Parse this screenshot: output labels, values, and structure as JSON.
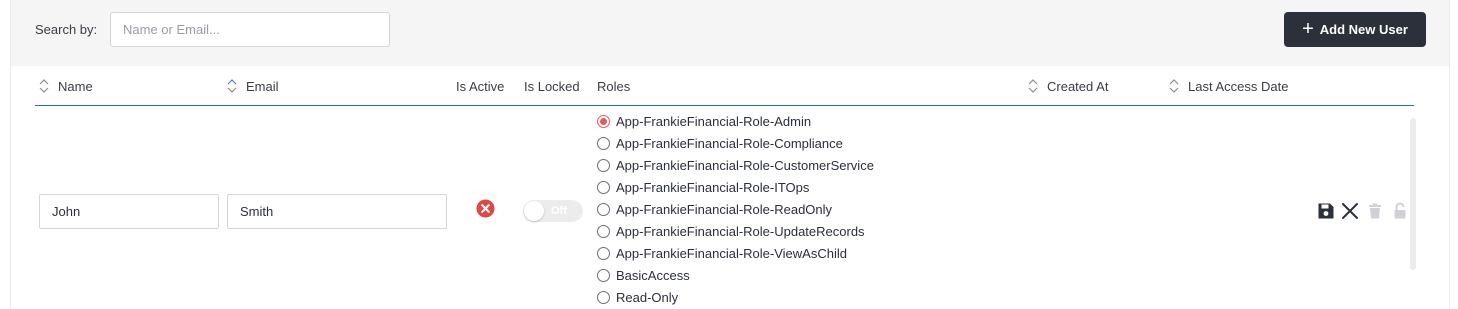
{
  "toolbar": {
    "search_label": "Search by:",
    "search_placeholder": "Name or Email...",
    "search_value": "",
    "add_button_label": "Add New User"
  },
  "columns": {
    "name": "Name",
    "email": "Email",
    "is_active": "Is Active",
    "is_locked": "Is Locked",
    "roles": "Roles",
    "created_at": "Created At",
    "last_access": "Last Access Date"
  },
  "row": {
    "first_name": "John",
    "last_name": "Smith",
    "is_active": "inactive",
    "locked_toggle_label": "Off",
    "roles": [
      "App-FrankieFinancial-Role-Admin",
      "App-FrankieFinancial-Role-Compliance",
      "App-FrankieFinancial-Role-CustomerService",
      "App-FrankieFinancial-Role-ITOps",
      "App-FrankieFinancial-Role-ReadOnly",
      "App-FrankieFinancial-Role-UpdateRecords",
      "App-FrankieFinancial-Role-ViewAsChild",
      "BasicAccess",
      "Read-Only"
    ],
    "selected_role_index": 0,
    "actions": [
      "save-icon",
      "close-icon",
      "trash-icon",
      "lock-icon"
    ]
  },
  "colors": {
    "accent": "#1e7f8a",
    "button_bg": "#2b303b",
    "error": "#e04848",
    "radio_checked": "#e25b5b"
  }
}
